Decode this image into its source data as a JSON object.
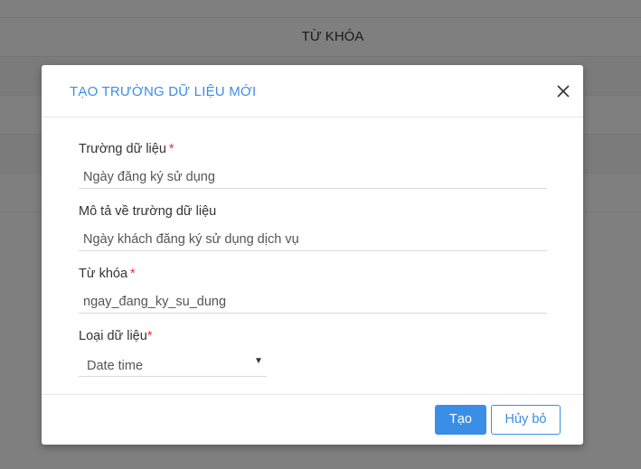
{
  "background": {
    "column_header": "TỪ KHÓA"
  },
  "modal": {
    "title": "TẠO TRƯỜNG DỮ LIỆU MỚI",
    "close_icon": "close-icon",
    "fields": {
      "field_name": {
        "label": "Trường dữ liệu",
        "required_mark": "*",
        "value": "Ngày đăng ký sử dụng"
      },
      "description": {
        "label": "Mô tả về trường dữ liệu",
        "value": "Ngày khách đăng ký sử dụng dịch vụ"
      },
      "keyword": {
        "label": "Từ khóa",
        "required_mark": "*",
        "value": "ngay_đang_ky_su_dung"
      },
      "data_type": {
        "label": "Loại dữ liệu",
        "required_mark": "*",
        "selected": "Date time",
        "caret": "▼"
      }
    },
    "footer": {
      "create_label": "Tạo",
      "cancel_label": "Hủy bỏ"
    }
  },
  "colors": {
    "accent": "#3a8ee6",
    "required": "#e0323a",
    "overlay": "rgba(0,0,0,0.5)"
  }
}
